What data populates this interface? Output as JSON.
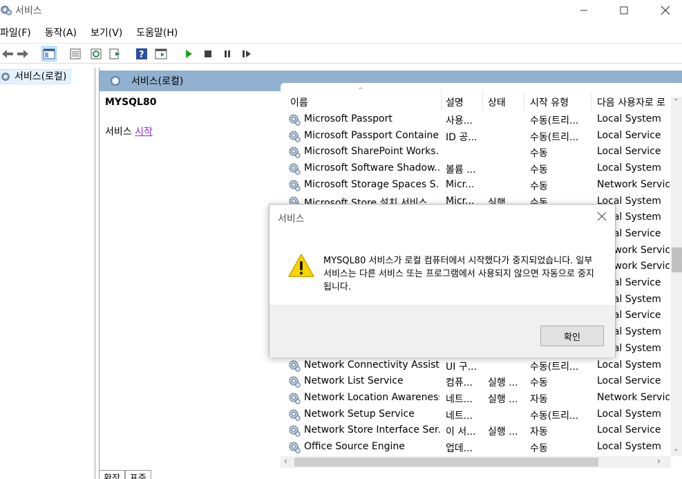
{
  "window": {
    "title": "서비스"
  },
  "menu": [
    "파일(F)",
    "동작(A)",
    "보기(V)",
    "도움말(H)"
  ],
  "toolbar": {
    "icons": [
      "back-arrow-icon",
      "forward-arrow-icon",
      "console-tree-icon",
      "properties-icon",
      "refresh-icon",
      "export-list-icon",
      "help-icon",
      "show-pane-icon",
      "start-service-icon",
      "stop-service-icon",
      "pause-service-icon",
      "resume-service-icon"
    ]
  },
  "tree": {
    "root_label": "서비스(로컬)"
  },
  "pane": {
    "header": "서비스(로컬)",
    "selected_service": "MYSQL80",
    "action_prefix": "서비스",
    "action_link": "시작"
  },
  "list": {
    "columns": [
      "이름",
      "설명",
      "상태",
      "시작 유형",
      "다음 사용자로 로"
    ],
    "rows": [
      {
        "name": "Microsoft Passport",
        "desc": "사용...",
        "state": "",
        "startup": "수동(트리...",
        "logon": "Local System"
      },
      {
        "name": "Microsoft Passport Container",
        "desc": "ID 공...",
        "state": "",
        "startup": "수동(트리...",
        "logon": "Local Service"
      },
      {
        "name": "Microsoft SharePoint Works...",
        "desc": "",
        "state": "",
        "startup": "수동",
        "logon": "Local Service"
      },
      {
        "name": "Microsoft Software Shadow...",
        "desc": "볼륨 ...",
        "state": "",
        "startup": "수동",
        "logon": "Local System"
      },
      {
        "name": "Microsoft Storage Spaces S...",
        "desc": "Micr...",
        "state": "",
        "startup": "수동",
        "logon": "Network Service"
      },
      {
        "name": "Microsoft Store 설치 서비스",
        "desc": "Micr...",
        "state": "실행",
        "startup": "수동",
        "logon": "Local System"
      },
      {
        "name": "",
        "desc": "",
        "state": "",
        "startup": "",
        "logon": "Local System"
      },
      {
        "name": "",
        "desc": "",
        "state": "",
        "startup": "",
        "logon": "Local Service"
      },
      {
        "name": "",
        "desc": "",
        "state": "",
        "startup": "",
        "logon": "Network Service"
      },
      {
        "name": "",
        "desc": "",
        "state": "",
        "startup": "",
        "logon": "Network Service"
      },
      {
        "name": "",
        "desc": "",
        "state": "",
        "startup": "",
        "logon": "Local Service"
      },
      {
        "name": "",
        "desc": "",
        "state": "",
        "startup": "",
        "logon": "Local System"
      },
      {
        "name": "",
        "desc": "",
        "state": "",
        "startup": "",
        "logon": "Local Service"
      },
      {
        "name": "",
        "desc": "",
        "state": "",
        "startup": "",
        "logon": "Local System"
      },
      {
        "name": "",
        "desc": "",
        "state": "",
        "startup": "",
        "logon": "Local System"
      },
      {
        "name": "Network Connectivity Assist...",
        "desc": "UI 구...",
        "state": "",
        "startup": "수동(트리...",
        "logon": "Local System"
      },
      {
        "name": "Network List Service",
        "desc": "컴퓨...",
        "state": "실행 ...",
        "startup": "수동",
        "logon": "Local Service"
      },
      {
        "name": "Network Location Awareness",
        "desc": "네트...",
        "state": "실행 ...",
        "startup": "자동",
        "logon": "Network Service"
      },
      {
        "name": "Network Setup Service",
        "desc": "네트...",
        "state": "",
        "startup": "수동(트리...",
        "logon": "Local System"
      },
      {
        "name": "Network Store Interface Ser...",
        "desc": "이 서...",
        "state": "실행 ...",
        "startup": "자동",
        "logon": "Local Service"
      },
      {
        "name": "Office  Source Engine",
        "desc": "업데...",
        "state": "",
        "startup": "수동",
        "logon": "Local System"
      }
    ]
  },
  "tabs": [
    "확장",
    "표준"
  ],
  "dialog": {
    "title": "서비스",
    "message": "MYSQL80 서비스가 로컬 컴퓨터에서 시작했다가 중지되었습니다. 일부 서비스는 다른 서비스 또는 프로그램에서 사용되지 않으면 자동으로 중지됩니다.",
    "ok_label": "확인"
  }
}
